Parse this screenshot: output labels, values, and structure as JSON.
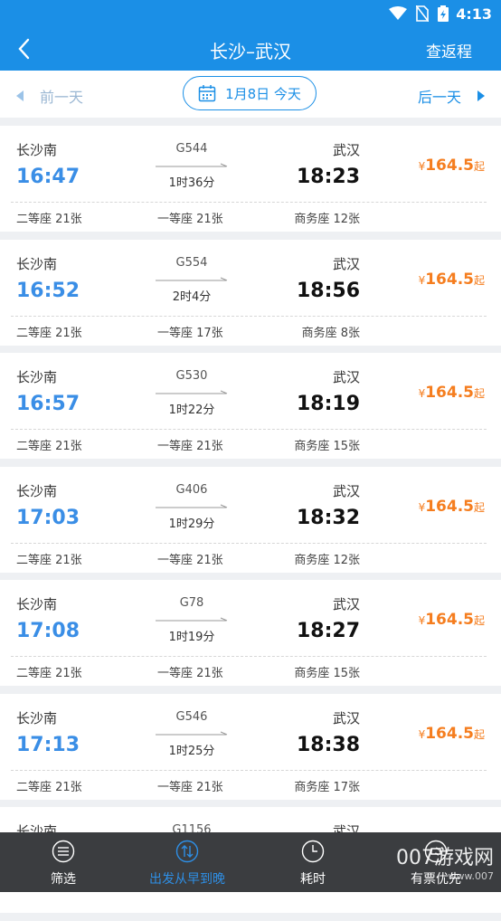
{
  "status": {
    "time": "4:13"
  },
  "header": {
    "title": "长沙–武汉",
    "return_label": "查返程"
  },
  "datebar": {
    "prev": "前一天",
    "date": "1月8日 今天",
    "next": "后一天"
  },
  "trains": [
    {
      "from": "长沙南",
      "dep": "16:47",
      "train": "G544",
      "duration": "1时36分",
      "to": "武汉",
      "arr": "18:23",
      "price": "164.5",
      "seat1": "二等座 21张",
      "seat2": "一等座 21张",
      "seat3": "商务座 12张"
    },
    {
      "from": "长沙南",
      "dep": "16:52",
      "train": "G554",
      "duration": "2时4分",
      "to": "武汉",
      "arr": "18:56",
      "price": "164.5",
      "seat1": "二等座 21张",
      "seat2": "一等座 17张",
      "seat3": "商务座 8张"
    },
    {
      "from": "长沙南",
      "dep": "16:57",
      "train": "G530",
      "duration": "1时22分",
      "to": "武汉",
      "arr": "18:19",
      "price": "164.5",
      "seat1": "二等座 21张",
      "seat2": "一等座 21张",
      "seat3": "商务座 15张"
    },
    {
      "from": "长沙南",
      "dep": "17:03",
      "train": "G406",
      "duration": "1时29分",
      "to": "武汉",
      "arr": "18:32",
      "price": "164.5",
      "seat1": "二等座 21张",
      "seat2": "一等座 21张",
      "seat3": "商务座 12张"
    },
    {
      "from": "长沙南",
      "dep": "17:08",
      "train": "G78",
      "duration": "1时19分",
      "to": "武汉",
      "arr": "18:27",
      "price": "164.5",
      "seat1": "二等座 21张",
      "seat2": "一等座 21张",
      "seat3": "商务座 15张"
    },
    {
      "from": "长沙南",
      "dep": "17:13",
      "train": "G546",
      "duration": "1时25分",
      "to": "武汉",
      "arr": "18:38",
      "price": "164.5",
      "seat1": "二等座 21张",
      "seat2": "一等座 21张",
      "seat3": "商务座 17张"
    },
    {
      "from": "长沙南",
      "dep": "",
      "train": "G1156",
      "duration": "",
      "to": "武汉",
      "arr": "",
      "price": "",
      "seat1": "",
      "seat2": "",
      "seat3": ""
    }
  ],
  "price_prefix": "¥",
  "price_suffix": "起",
  "tabs": {
    "filter": "筛选",
    "sort_departure": "出发从早到晚",
    "duration": "耗时",
    "price": "有票优先"
  },
  "watermark": {
    "main": "007游戏网",
    "sub": "www.007"
  },
  "colors": {
    "brand": "#1b8fe6",
    "departure_time": "#3a8ee6",
    "price": "#f57d1e",
    "tabbar": "#3b3d40"
  }
}
